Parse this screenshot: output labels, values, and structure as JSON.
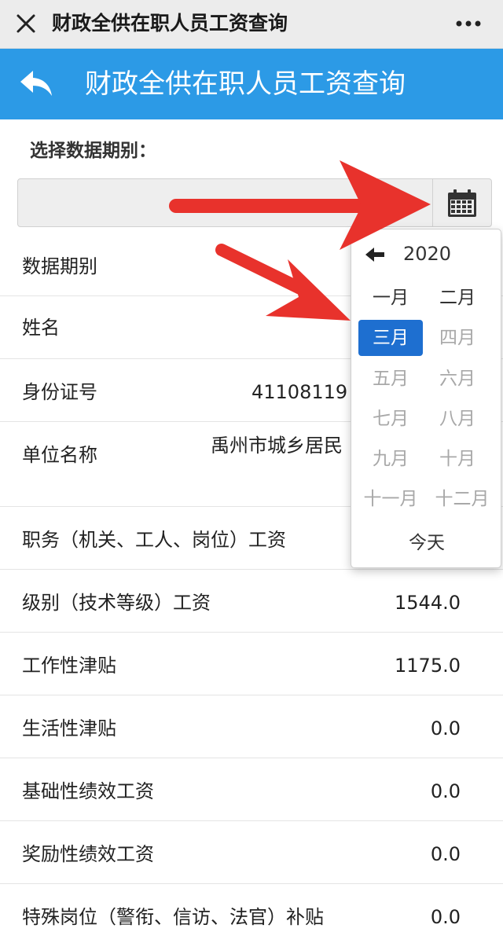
{
  "wechat_bar": {
    "title": "财政全供在职人员工资查询",
    "close_icon": "close-icon",
    "more_icon": "more-icon"
  },
  "header": {
    "title": "财政全供在职人员工资查询",
    "back_icon": "back-arrow-icon",
    "color": "#2c9ae6"
  },
  "period": {
    "label": "选择数据期别：",
    "value": "",
    "calendar_icon": "calendar-icon"
  },
  "rows": [
    {
      "label": "数据期别",
      "value": ""
    },
    {
      "label": "姓名",
      "value": ""
    },
    {
      "label": "身份证号",
      "value": "41108119"
    },
    {
      "label": "单位名称",
      "value": "禹州市城乡居民"
    },
    {
      "label": "职务（机关、工人、岗位）工资",
      "value": ""
    },
    {
      "label": "级别（技术等级）工资",
      "value": "1544.0"
    },
    {
      "label": "工作性津贴",
      "value": "1175.0"
    },
    {
      "label": "生活性津贴",
      "value": "0.0"
    },
    {
      "label": "基础性绩效工资",
      "value": "0.0"
    },
    {
      "label": "奖励性绩效工资",
      "value": "0.0"
    },
    {
      "label": "特殊岗位（警衔、信访、法官）补贴",
      "value": "0.0"
    }
  ],
  "picker": {
    "year": "2020",
    "prev_icon": "arrow-left-icon",
    "selected_color": "#1e6fd0",
    "months": [
      {
        "label": "一月",
        "state": "enabled"
      },
      {
        "label": "二月",
        "state": "enabled"
      },
      {
        "label": "三月",
        "state": "selected"
      },
      {
        "label": "四月",
        "state": "disabled"
      },
      {
        "label": "五月",
        "state": "disabled"
      },
      {
        "label": "六月",
        "state": "disabled"
      },
      {
        "label": "七月",
        "state": "disabled"
      },
      {
        "label": "八月",
        "state": "disabled"
      },
      {
        "label": "九月",
        "state": "disabled"
      },
      {
        "label": "十月",
        "state": "disabled"
      },
      {
        "label": "十一月",
        "state": "disabled"
      },
      {
        "label": "十二月",
        "state": "disabled"
      }
    ],
    "today_label": "今天"
  },
  "annotation": {
    "arrow_color": "#e8322c"
  }
}
